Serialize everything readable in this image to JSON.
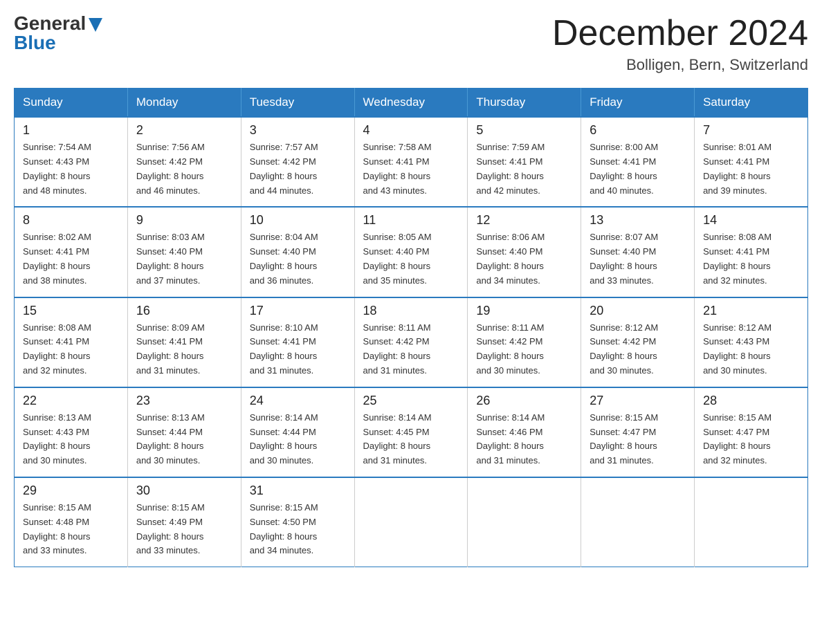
{
  "logo": {
    "general": "General",
    "blue": "Blue"
  },
  "title": "December 2024",
  "location": "Bolligen, Bern, Switzerland",
  "days_of_week": [
    "Sunday",
    "Monday",
    "Tuesday",
    "Wednesday",
    "Thursday",
    "Friday",
    "Saturday"
  ],
  "weeks": [
    [
      {
        "day": "1",
        "sunrise": "Sunrise: 7:54 AM",
        "sunset": "Sunset: 4:43 PM",
        "daylight": "Daylight: 8 hours",
        "daylight2": "and 48 minutes."
      },
      {
        "day": "2",
        "sunrise": "Sunrise: 7:56 AM",
        "sunset": "Sunset: 4:42 PM",
        "daylight": "Daylight: 8 hours",
        "daylight2": "and 46 minutes."
      },
      {
        "day": "3",
        "sunrise": "Sunrise: 7:57 AM",
        "sunset": "Sunset: 4:42 PM",
        "daylight": "Daylight: 8 hours",
        "daylight2": "and 44 minutes."
      },
      {
        "day": "4",
        "sunrise": "Sunrise: 7:58 AM",
        "sunset": "Sunset: 4:41 PM",
        "daylight": "Daylight: 8 hours",
        "daylight2": "and 43 minutes."
      },
      {
        "day": "5",
        "sunrise": "Sunrise: 7:59 AM",
        "sunset": "Sunset: 4:41 PM",
        "daylight": "Daylight: 8 hours",
        "daylight2": "and 42 minutes."
      },
      {
        "day": "6",
        "sunrise": "Sunrise: 8:00 AM",
        "sunset": "Sunset: 4:41 PM",
        "daylight": "Daylight: 8 hours",
        "daylight2": "and 40 minutes."
      },
      {
        "day": "7",
        "sunrise": "Sunrise: 8:01 AM",
        "sunset": "Sunset: 4:41 PM",
        "daylight": "Daylight: 8 hours",
        "daylight2": "and 39 minutes."
      }
    ],
    [
      {
        "day": "8",
        "sunrise": "Sunrise: 8:02 AM",
        "sunset": "Sunset: 4:41 PM",
        "daylight": "Daylight: 8 hours",
        "daylight2": "and 38 minutes."
      },
      {
        "day": "9",
        "sunrise": "Sunrise: 8:03 AM",
        "sunset": "Sunset: 4:40 PM",
        "daylight": "Daylight: 8 hours",
        "daylight2": "and 37 minutes."
      },
      {
        "day": "10",
        "sunrise": "Sunrise: 8:04 AM",
        "sunset": "Sunset: 4:40 PM",
        "daylight": "Daylight: 8 hours",
        "daylight2": "and 36 minutes."
      },
      {
        "day": "11",
        "sunrise": "Sunrise: 8:05 AM",
        "sunset": "Sunset: 4:40 PM",
        "daylight": "Daylight: 8 hours",
        "daylight2": "and 35 minutes."
      },
      {
        "day": "12",
        "sunrise": "Sunrise: 8:06 AM",
        "sunset": "Sunset: 4:40 PM",
        "daylight": "Daylight: 8 hours",
        "daylight2": "and 34 minutes."
      },
      {
        "day": "13",
        "sunrise": "Sunrise: 8:07 AM",
        "sunset": "Sunset: 4:40 PM",
        "daylight": "Daylight: 8 hours",
        "daylight2": "and 33 minutes."
      },
      {
        "day": "14",
        "sunrise": "Sunrise: 8:08 AM",
        "sunset": "Sunset: 4:41 PM",
        "daylight": "Daylight: 8 hours",
        "daylight2": "and 32 minutes."
      }
    ],
    [
      {
        "day": "15",
        "sunrise": "Sunrise: 8:08 AM",
        "sunset": "Sunset: 4:41 PM",
        "daylight": "Daylight: 8 hours",
        "daylight2": "and 32 minutes."
      },
      {
        "day": "16",
        "sunrise": "Sunrise: 8:09 AM",
        "sunset": "Sunset: 4:41 PM",
        "daylight": "Daylight: 8 hours",
        "daylight2": "and 31 minutes."
      },
      {
        "day": "17",
        "sunrise": "Sunrise: 8:10 AM",
        "sunset": "Sunset: 4:41 PM",
        "daylight": "Daylight: 8 hours",
        "daylight2": "and 31 minutes."
      },
      {
        "day": "18",
        "sunrise": "Sunrise: 8:11 AM",
        "sunset": "Sunset: 4:42 PM",
        "daylight": "Daylight: 8 hours",
        "daylight2": "and 31 minutes."
      },
      {
        "day": "19",
        "sunrise": "Sunrise: 8:11 AM",
        "sunset": "Sunset: 4:42 PM",
        "daylight": "Daylight: 8 hours",
        "daylight2": "and 30 minutes."
      },
      {
        "day": "20",
        "sunrise": "Sunrise: 8:12 AM",
        "sunset": "Sunset: 4:42 PM",
        "daylight": "Daylight: 8 hours",
        "daylight2": "and 30 minutes."
      },
      {
        "day": "21",
        "sunrise": "Sunrise: 8:12 AM",
        "sunset": "Sunset: 4:43 PM",
        "daylight": "Daylight: 8 hours",
        "daylight2": "and 30 minutes."
      }
    ],
    [
      {
        "day": "22",
        "sunrise": "Sunrise: 8:13 AM",
        "sunset": "Sunset: 4:43 PM",
        "daylight": "Daylight: 8 hours",
        "daylight2": "and 30 minutes."
      },
      {
        "day": "23",
        "sunrise": "Sunrise: 8:13 AM",
        "sunset": "Sunset: 4:44 PM",
        "daylight": "Daylight: 8 hours",
        "daylight2": "and 30 minutes."
      },
      {
        "day": "24",
        "sunrise": "Sunrise: 8:14 AM",
        "sunset": "Sunset: 4:44 PM",
        "daylight": "Daylight: 8 hours",
        "daylight2": "and 30 minutes."
      },
      {
        "day": "25",
        "sunrise": "Sunrise: 8:14 AM",
        "sunset": "Sunset: 4:45 PM",
        "daylight": "Daylight: 8 hours",
        "daylight2": "and 31 minutes."
      },
      {
        "day": "26",
        "sunrise": "Sunrise: 8:14 AM",
        "sunset": "Sunset: 4:46 PM",
        "daylight": "Daylight: 8 hours",
        "daylight2": "and 31 minutes."
      },
      {
        "day": "27",
        "sunrise": "Sunrise: 8:15 AM",
        "sunset": "Sunset: 4:47 PM",
        "daylight": "Daylight: 8 hours",
        "daylight2": "and 31 minutes."
      },
      {
        "day": "28",
        "sunrise": "Sunrise: 8:15 AM",
        "sunset": "Sunset: 4:47 PM",
        "daylight": "Daylight: 8 hours",
        "daylight2": "and 32 minutes."
      }
    ],
    [
      {
        "day": "29",
        "sunrise": "Sunrise: 8:15 AM",
        "sunset": "Sunset: 4:48 PM",
        "daylight": "Daylight: 8 hours",
        "daylight2": "and 33 minutes."
      },
      {
        "day": "30",
        "sunrise": "Sunrise: 8:15 AM",
        "sunset": "Sunset: 4:49 PM",
        "daylight": "Daylight: 8 hours",
        "daylight2": "and 33 minutes."
      },
      {
        "day": "31",
        "sunrise": "Sunrise: 8:15 AM",
        "sunset": "Sunset: 4:50 PM",
        "daylight": "Daylight: 8 hours",
        "daylight2": "and 34 minutes."
      },
      null,
      null,
      null,
      null
    ]
  ]
}
